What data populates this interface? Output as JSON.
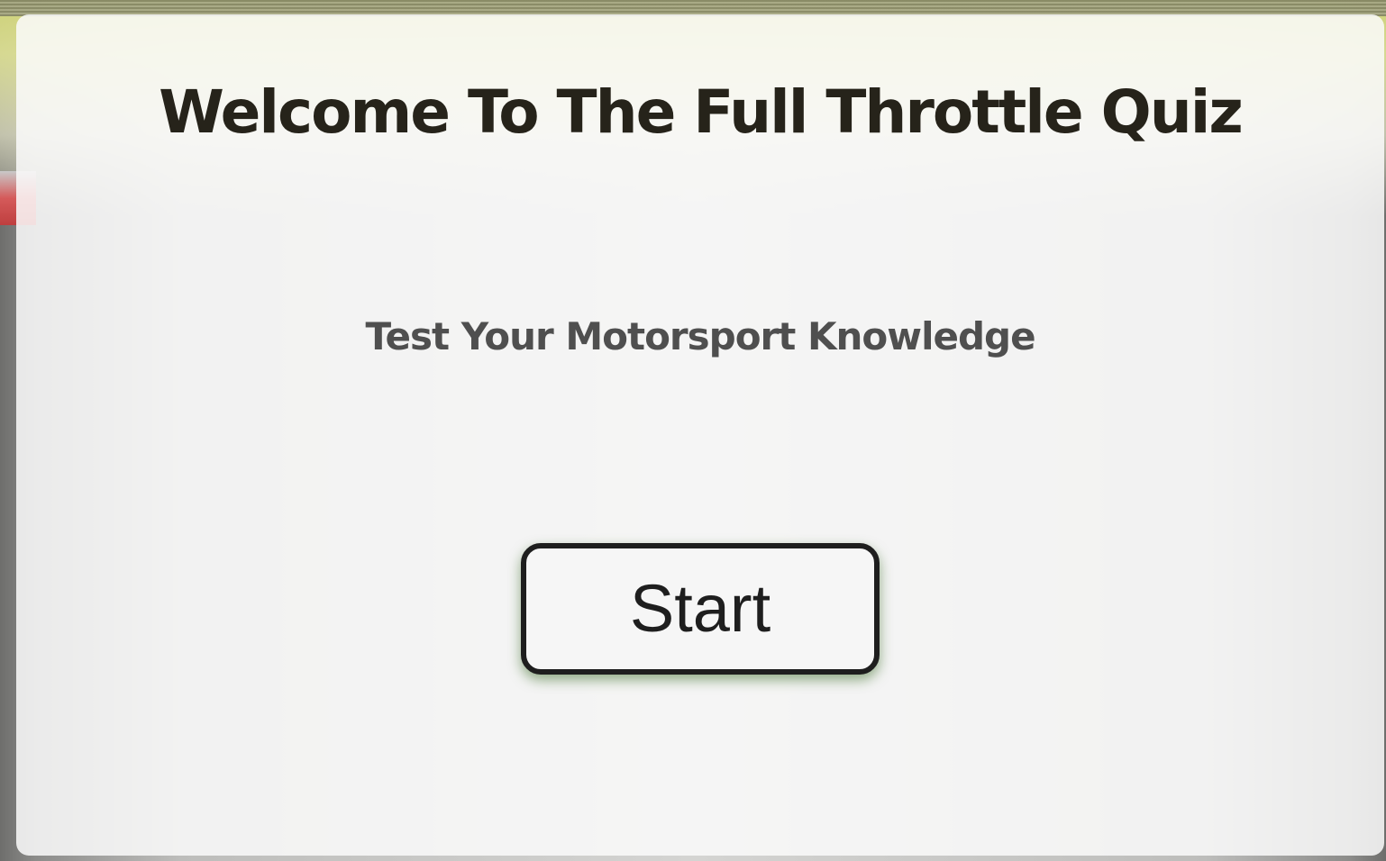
{
  "page": {
    "title": "Welcome To The Full Throttle Quiz",
    "subtitle": "Test Your Motorsport Knowledge"
  },
  "controls": {
    "start_label": "Start"
  },
  "colors": {
    "panel_background": "#fafafa",
    "title_text": "#26231a",
    "subtitle_text": "#4f4f4f",
    "button_border": "#1e1e1e",
    "button_glow": "#3c6e28"
  }
}
